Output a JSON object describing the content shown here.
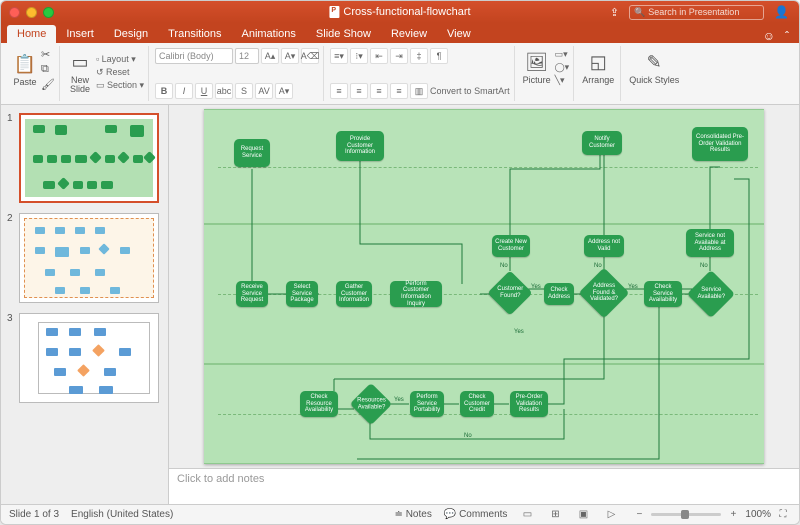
{
  "title": "Cross-functional-flowchart",
  "search_placeholder": "Search in Presentation",
  "tabs": [
    "Home",
    "Insert",
    "Design",
    "Transitions",
    "Animations",
    "Slide Show",
    "Review",
    "View"
  ],
  "active_tab": 0,
  "ribbon": {
    "paste": "Paste",
    "new_slide": "New\nSlide",
    "layout": "Layout",
    "reset": "Reset",
    "section": "Section",
    "font_name": "Calibri (Body)",
    "font_size": "12",
    "convert_smartart": "Convert to SmartArt",
    "picture": "Picture",
    "arrange": "Arrange",
    "quick_styles": "Quick Styles"
  },
  "slides": {
    "count": 3,
    "selected": 1
  },
  "notes_placeholder": "Click to add notes",
  "status": {
    "slide_info": "Slide 1 of 3",
    "language": "English (United States)",
    "notes": "Notes",
    "comments": "Comments",
    "zoom": "100%"
  },
  "nodes": {
    "n1": "Request Service",
    "n2": "Provide Customer Information",
    "n3": "Notify Customer",
    "n4": "Consolidated Pre-Order Validation Results",
    "n5": "Receive Service Request",
    "n6": "Select Service Package",
    "n7": "Gather Customer Information",
    "n8": "Perform Customer Information Inquiry",
    "n9": "Customer Found?",
    "n10": "Create New Customer",
    "n11": "Check Address",
    "n12": "Address Found & Validated?",
    "n13": "Address not Valid",
    "n14": "Check Service Availability",
    "n15": "Service Available?",
    "n16": "Service not Available at Address",
    "n17": "Check Resource Availability",
    "n18": "Resources Available?",
    "n19": "Perform Service Portability",
    "n20": "Check Customer Credit",
    "n21": "Pre-Order Validation Results"
  },
  "labels": {
    "yes": "Yes",
    "no": "No"
  }
}
